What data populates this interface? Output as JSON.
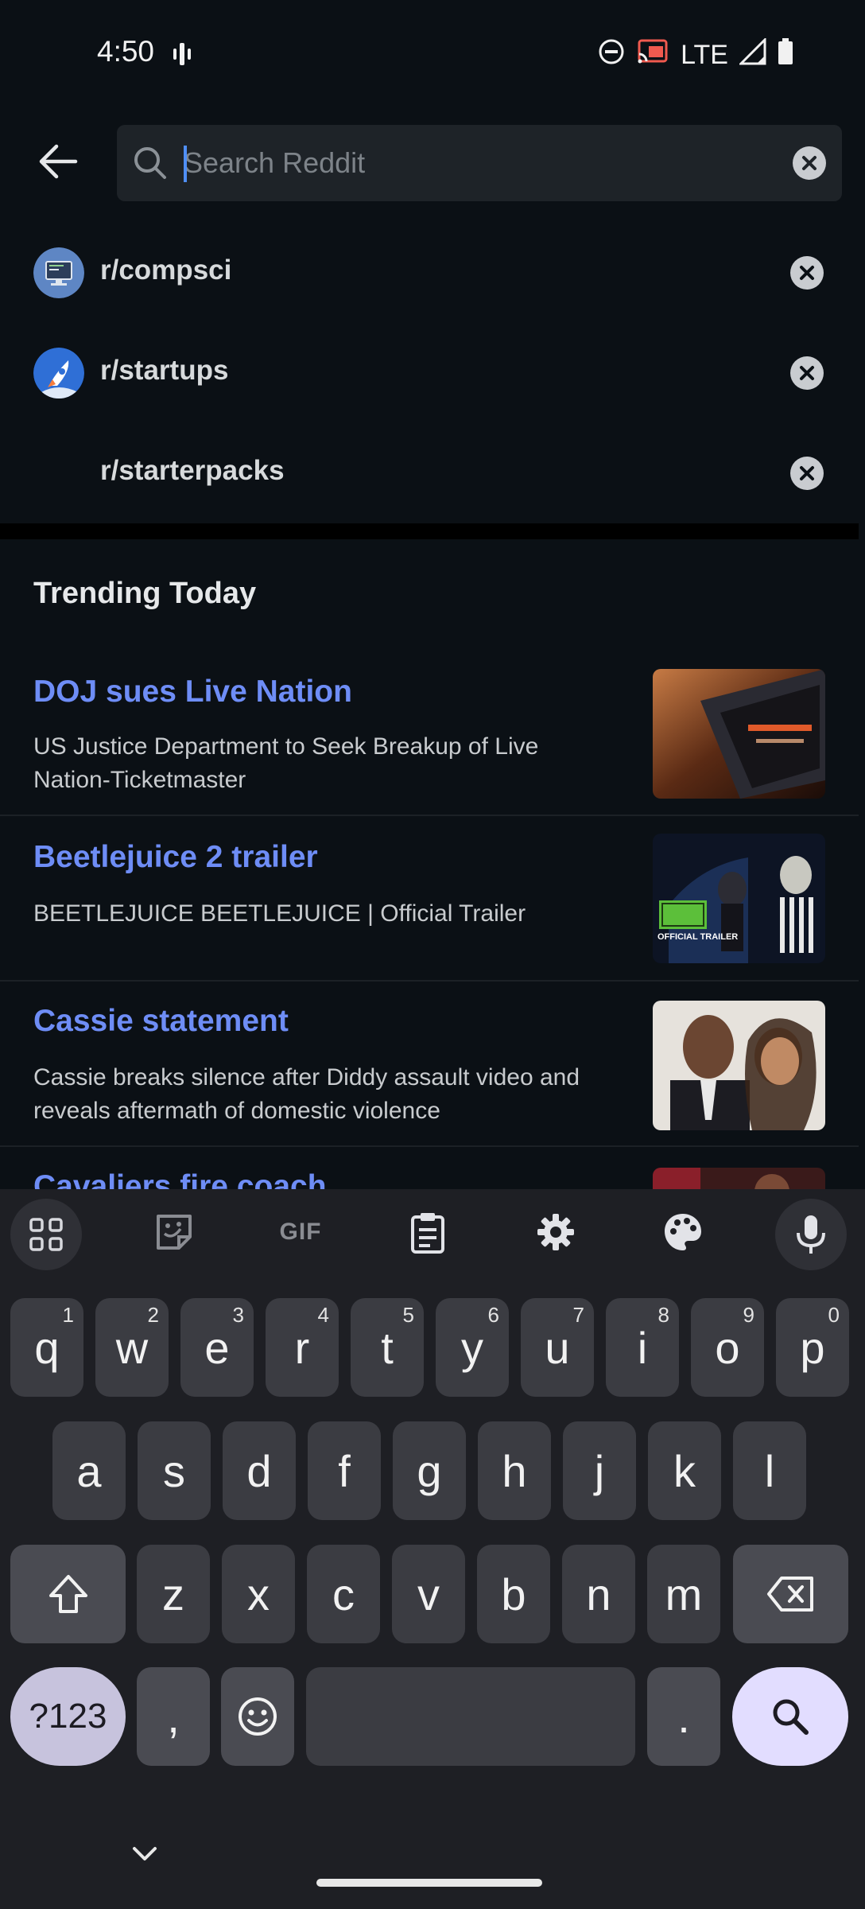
{
  "status_bar": {
    "time": "4:50",
    "network": "LTE",
    "icons": [
      "vibrate-icon",
      "dnd-icon",
      "cast-icon",
      "signal-icon",
      "battery-icon"
    ]
  },
  "search": {
    "placeholder": "Search Reddit",
    "value": ""
  },
  "recent_searches": [
    {
      "label": "r/compsci",
      "icon": "compsci-avatar"
    },
    {
      "label": "r/startups",
      "icon": "startups-avatar"
    },
    {
      "label": "r/starterpacks",
      "icon": ""
    }
  ],
  "trending": {
    "heading": "Trending Today",
    "items": [
      {
        "title": "DOJ sues Live Nation",
        "subtitle": "US Justice Department to Seek Breakup of Live Nation-Ticketmaster",
        "thumb": "live-nation-thumbnail"
      },
      {
        "title": "Beetlejuice 2 trailer",
        "subtitle": "BEETLEJUICE BEETLEJUICE | Official Trailer",
        "thumb": "beetlejuice-thumbnail",
        "thumb_caption": "OFFICIAL TRAILER"
      },
      {
        "title": "Cassie statement",
        "subtitle": "Cassie breaks silence after Diddy assault video and reveals aftermath of domestic violence",
        "thumb": "cassie-thumbnail"
      },
      {
        "title": "Cavaliers fire coach",
        "subtitle": "",
        "thumb": "cavaliers-thumbnail"
      }
    ]
  },
  "keyboard": {
    "toolbar": {
      "gif_label": "GIF"
    },
    "row1": [
      {
        "key": "q",
        "hint": "1"
      },
      {
        "key": "w",
        "hint": "2"
      },
      {
        "key": "e",
        "hint": "3"
      },
      {
        "key": "r",
        "hint": "4"
      },
      {
        "key": "t",
        "hint": "5"
      },
      {
        "key": "y",
        "hint": "6"
      },
      {
        "key": "u",
        "hint": "7"
      },
      {
        "key": "i",
        "hint": "8"
      },
      {
        "key": "o",
        "hint": "9"
      },
      {
        "key": "p",
        "hint": "0"
      }
    ],
    "row2": [
      "a",
      "s",
      "d",
      "f",
      "g",
      "h",
      "j",
      "k",
      "l"
    ],
    "row3": [
      "z",
      "x",
      "c",
      "v",
      "b",
      "n",
      "m"
    ],
    "symbols_label": "?123",
    "comma": ",",
    "period": "."
  },
  "colors": {
    "background": "#0b1015",
    "accent_link": "#6e8df6",
    "keyboard_bg": "#1e1f24",
    "key_bg": "#3b3c42"
  }
}
